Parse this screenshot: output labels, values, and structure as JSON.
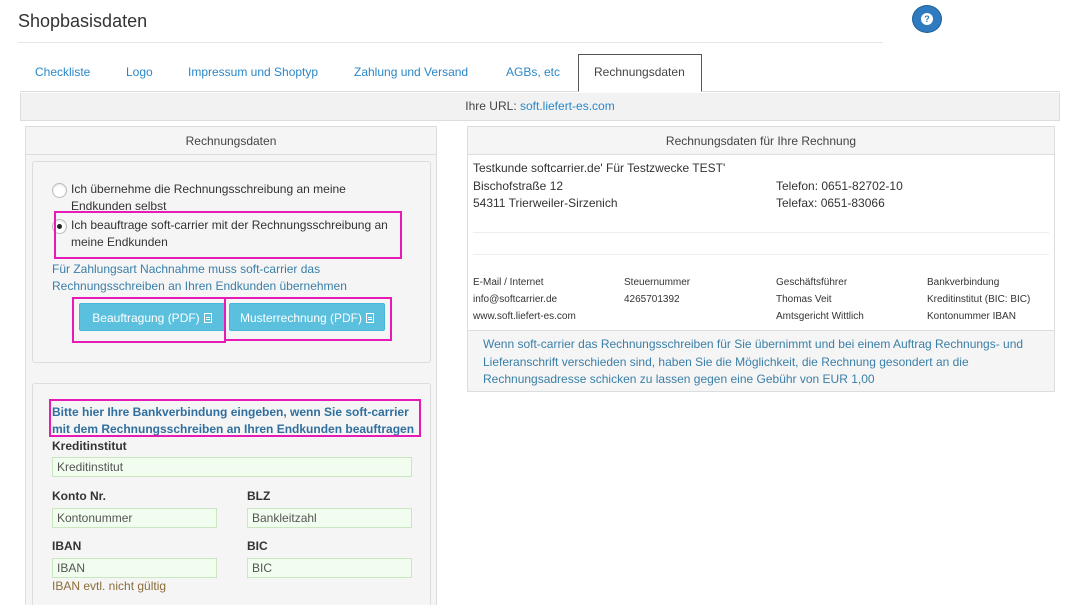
{
  "page": {
    "title": "Shopbasisdaten",
    "help_label": "?"
  },
  "tabs": [
    {
      "label": "Checkliste"
    },
    {
      "label": "Logo"
    },
    {
      "label": "Impressum und Shoptyp"
    },
    {
      "label": "Zahlung und Versand"
    },
    {
      "label": "AGBs, etc"
    },
    {
      "label": "Rechnungsdaten"
    }
  ],
  "url_bar": {
    "label": "Ihre URL:",
    "url": "soft.liefert-es.com"
  },
  "left": {
    "title": "Rechnungsdaten",
    "radio1": "Ich übernehme die Rechnungsschreibung an meine Endkunden selbst",
    "radio2": "Ich beauftrage soft-carrier mit der Rechnungsschreibung an meine Endkunden",
    "info": "Für Zahlungsart Nachnahme muss soft-carrier das Rechnungsschreiben an Ihren Endkunden übernehmen",
    "btn1": "Beauftragung (PDF)",
    "btn2": "Musterrechnung (PDF)",
    "bank_info": "Bitte hier Ihre Bankverbindung eingeben, wenn Sie soft-carrier mit dem Rechnungsschreiben an Ihren Endkunden beauftragen",
    "kreditinstitut_label": "Kreditinstitut",
    "kreditinstitut_value": "Kreditinstitut",
    "konto_label": "Konto Nr.",
    "konto_value": "Kontonummer",
    "blz_label": "BLZ",
    "blz_value": "Bankleitzahl",
    "iban_label": "IBAN",
    "iban_value": "IBAN",
    "bic_label": "BIC",
    "bic_value": "BIC",
    "iban_warning": "IBAN evtl. nicht gültig"
  },
  "right": {
    "title": "Rechnungsdaten für Ihre Rechnung",
    "company": "Testkunde softcarrier.de' Für Testzwecke TEST'",
    "street": "Bischofstraße 12",
    "city": "54311 Trierweiler-Sirzenich",
    "phone": "Telefon: 0651-82702-10",
    "fax": "Telefax: 0651-83066",
    "footer": {
      "col1": [
        "E-Mail / Internet",
        "info@softcarrier.de",
        "www.soft.liefert-es.com"
      ],
      "col2": [
        "Steuernummer",
        "4265701392"
      ],
      "col3": [
        "Geschäftsführer",
        "Thomas Veit",
        "Amtsgericht Wittlich"
      ],
      "col4": [
        "Bankverbindung",
        "Kreditinstitut (BIC: BIC)",
        "Kontonummer IBAN"
      ]
    },
    "note": "Wenn soft-carrier das Rechnungsschreiben für Sie übernimmt und bei einem Auftrag Rechnungs- und Lieferanschrift verschieden sind, haben Sie die Möglichkeit, die Rechnung gesondert an die Rechnungsadresse schicken zu lassen gegen eine Gebühr von EUR 1,00"
  },
  "colors": {
    "link": "#2a87c7",
    "info": "#3a7fa8",
    "button": "#5bc0de",
    "highlight": "#e61bb6",
    "warning": "#8a6d3b"
  }
}
